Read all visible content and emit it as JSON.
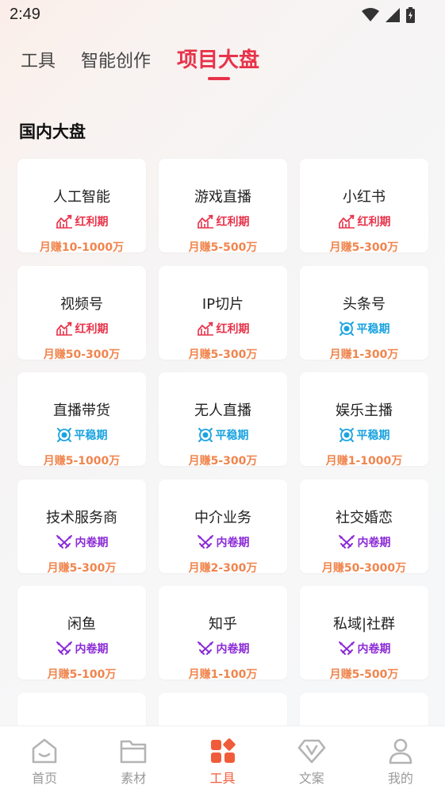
{
  "status": {
    "time": "2:49"
  },
  "tabs": [
    {
      "label": "工具"
    },
    {
      "label": "智能创作"
    },
    {
      "label": "项目大盘"
    }
  ],
  "section": {
    "title": "国内大盘"
  },
  "cards": [
    {
      "title": "人工智能",
      "badge": "红利期",
      "badge_type": "red",
      "earn": "月赚10-1000万"
    },
    {
      "title": "游戏直播",
      "badge": "红利期",
      "badge_type": "red",
      "earn": "月赚5-500万"
    },
    {
      "title": "小红书",
      "badge": "红利期",
      "badge_type": "red",
      "earn": "月赚5-300万"
    },
    {
      "title": "视频号",
      "badge": "红利期",
      "badge_type": "red",
      "earn": "月赚50-300万"
    },
    {
      "title": "IP切片",
      "badge": "红利期",
      "badge_type": "red",
      "earn": "月赚5-300万"
    },
    {
      "title": "头条号",
      "badge": "平稳期",
      "badge_type": "blue",
      "earn": "月赚1-300万"
    },
    {
      "title": "直播带货",
      "badge": "平稳期",
      "badge_type": "blue",
      "earn": "月赚5-1000万"
    },
    {
      "title": "无人直播",
      "badge": "平稳期",
      "badge_type": "blue",
      "earn": "月赚5-300万"
    },
    {
      "title": "娱乐主播",
      "badge": "平稳期",
      "badge_type": "blue",
      "earn": "月赚1-1000万"
    },
    {
      "title": "技术服务商",
      "badge": "内卷期",
      "badge_type": "purple",
      "earn": "月赚5-300万"
    },
    {
      "title": "中介业务",
      "badge": "内卷期",
      "badge_type": "purple",
      "earn": "月赚2-300万"
    },
    {
      "title": "社交婚恋",
      "badge": "内卷期",
      "badge_type": "purple",
      "earn": "月赚50-3000万"
    },
    {
      "title": "闲鱼",
      "badge": "内卷期",
      "badge_type": "purple",
      "earn": "月赚5-100万"
    },
    {
      "title": "知乎",
      "badge": "内卷期",
      "badge_type": "purple",
      "earn": "月赚1-100万"
    },
    {
      "title": "私域|社群",
      "badge": "内卷期",
      "badge_type": "purple",
      "earn": "月赚5-500万"
    }
  ],
  "badge_icons": {
    "red": "trend-up-icon",
    "blue": "target-icon",
    "purple": "crossed-swords-icon"
  },
  "colors": {
    "red": "#e8334a",
    "blue": "#1aa3e0",
    "purple": "#8b2bd6",
    "earn": "#f0854e",
    "nav_active": "#f05c3a"
  },
  "nav": [
    {
      "label": "首页",
      "icon": "home-icon"
    },
    {
      "label": "素材",
      "icon": "folder-icon"
    },
    {
      "label": "工具",
      "icon": "tools-icon",
      "active": true
    },
    {
      "label": "文案",
      "icon": "diamond-v-icon"
    },
    {
      "label": "我的",
      "icon": "user-icon"
    }
  ]
}
